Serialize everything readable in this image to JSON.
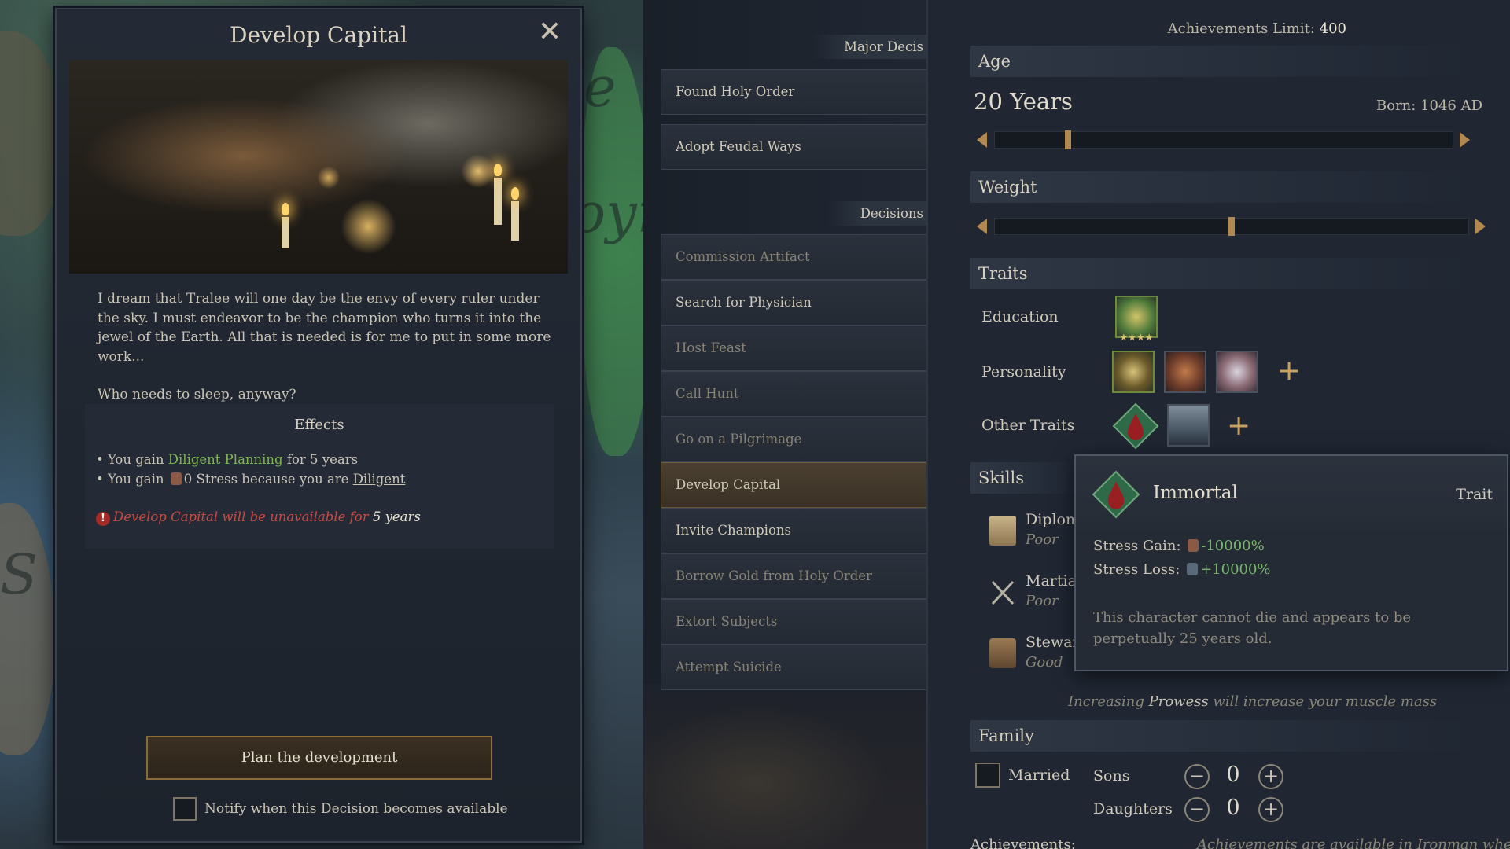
{
  "decision_window": {
    "title": "Develop Capital",
    "close_glyph": "✕",
    "description_1": "I dream that Tralee will one day be the envy of every ruler under the sky. I must endeavor to be the champion who turns it into the jewel of the Earth. All that is needed is for me to put in some more work...",
    "description_2": "Who needs to sleep, anyway?",
    "effects_title": "Effects",
    "effect_1": {
      "prefix": "• You gain ",
      "link": "Diligent Planning",
      "suffix": " for 5 years"
    },
    "effect_2": {
      "prefix": "• You gain ",
      "amount": "0",
      "stat": " Stress because you are ",
      "link": "Diligent"
    },
    "warning": {
      "icon": "!",
      "text": "Develop Capital will be unavailable for ",
      "years": "5 years"
    },
    "plan_button": "Plan the development",
    "notify_label": "Notify when this Decision becomes available"
  },
  "decisions_panel": {
    "major_header": "Major Decis",
    "major_items": [
      "Found Holy Order",
      "Adopt Feudal Ways"
    ],
    "decisions_header": "Decisions",
    "items": [
      {
        "label": "Commission Artifact",
        "state": "dim"
      },
      {
        "label": "Search for Physician",
        "state": "normal"
      },
      {
        "label": "Host Feast",
        "state": "dim"
      },
      {
        "label": "Call Hunt",
        "state": "dim"
      },
      {
        "label": "Go on a Pilgrimage",
        "state": "dim"
      },
      {
        "label": "Develop Capital",
        "state": "selected"
      },
      {
        "label": "Invite Champions",
        "state": "normal"
      },
      {
        "label": "Borrow Gold from Holy Order",
        "state": "dim"
      },
      {
        "label": "Extort Subjects",
        "state": "dim"
      },
      {
        "label": "Attempt Suicide",
        "state": "dim"
      }
    ]
  },
  "character": {
    "limit_label": "Achievements Limit: ",
    "limit_value": "400",
    "age_label": "Age",
    "age_value": "20 Years",
    "born": "Born: 1046 AD",
    "age_slider": 0.16,
    "weight_label": "Weight",
    "weight_slider": 0.5,
    "traits_label": "Traits",
    "education_label": "Education",
    "education_stars": "★★★★",
    "personality_label": "Personality",
    "other_traits_label": "Other Traits",
    "plus_glyph": "+",
    "skills_label": "Skills",
    "skills": [
      {
        "name": "Diplom",
        "rating": "Poor"
      },
      {
        "name": "Martial",
        "rating": "Poor"
      },
      {
        "name": "Stewar",
        "rating": "Good"
      }
    ],
    "prowess_prefix": "Increasing ",
    "prowess_word": "Prowess",
    "prowess_suffix": " will increase your muscle mass",
    "family_label": "Family",
    "married_label": "Married",
    "sons_label": "Sons",
    "sons_count": "0",
    "daughters_label": "Daughters",
    "daughters_count": "0",
    "minus_glyph": "−",
    "achievements_label": "Achievements:",
    "achievements_note": "Achievements are available in Ironman when"
  },
  "tooltip": {
    "title": "Immortal",
    "type": "Trait",
    "stress_gain_label": "Stress Gain: ",
    "stress_gain_value": "-10000%",
    "stress_loss_label": "Stress Loss: ",
    "stress_loss_value": "+10000%",
    "description": "This character cannot die and appears to be perpetually 25 years old."
  },
  "map": {
    "label_1": "e",
    "label_2": "oyr",
    "label_3": "S"
  },
  "colors": {
    "accent_gold": "#b08850",
    "positive_green": "#78b56a",
    "warning_red": "#c94a43"
  }
}
